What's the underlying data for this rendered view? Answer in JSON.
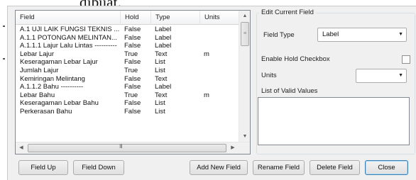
{
  "caption_fragment": "dibuat.",
  "list": {
    "columns": [
      "Field",
      "Hold",
      "Type",
      "Units"
    ],
    "rows": [
      {
        "field": "A.1 UJI LAIK FUNGSI TEKNIS ...",
        "hold": "False",
        "type": "Label",
        "units": ""
      },
      {
        "field": "A.1.1 POTONGAN MELINTAN...",
        "hold": "False",
        "type": "Label",
        "units": ""
      },
      {
        "field": "A.1.1.1 Lajur Lalu Lintas ----------",
        "hold": "False",
        "type": "Label",
        "units": ""
      },
      {
        "field": "Lebar Lajur",
        "hold": "True",
        "type": "Text",
        "units": "m"
      },
      {
        "field": "Keseragaman Lebar Lajur",
        "hold": "False",
        "type": "List",
        "units": ""
      },
      {
        "field": "Jumlah Lajur",
        "hold": "True",
        "type": "List",
        "units": ""
      },
      {
        "field": "Kemiringan Melintang",
        "hold": "False",
        "type": "Text",
        "units": ""
      },
      {
        "field": "A.1.1.2 Bahu ----------",
        "hold": "False",
        "type": "Label",
        "units": ""
      },
      {
        "field": "Lebar Bahu",
        "hold": "True",
        "type": "Text",
        "units": "m"
      },
      {
        "field": "Keseragaman Lebar Bahu",
        "hold": "False",
        "type": "List",
        "units": ""
      },
      {
        "field": "Perkerasan Bahu",
        "hold": "False",
        "type": "List",
        "units": ""
      }
    ],
    "scroll_grip": "III"
  },
  "edit": {
    "group_title": "Edit Current Field",
    "field_type_label": "Field Type",
    "field_type_value": "Label",
    "enable_hold_label": "Enable Hold Checkbox",
    "enable_hold_checked": false,
    "units_label": "Units",
    "units_value": "",
    "valid_values_label": "List of Valid Values"
  },
  "buttons": {
    "field_up": "Field Up",
    "field_down": "Field Down",
    "add_new_field": "Add New Field",
    "rename_field": "Rename Field",
    "delete_field": "Delete Field",
    "close": "Close"
  },
  "icons": {
    "scroll_up": "▲",
    "scroll_down": "▼",
    "scroll_left": "◀",
    "scroll_right": "▶",
    "combo_arrow": "▼"
  }
}
